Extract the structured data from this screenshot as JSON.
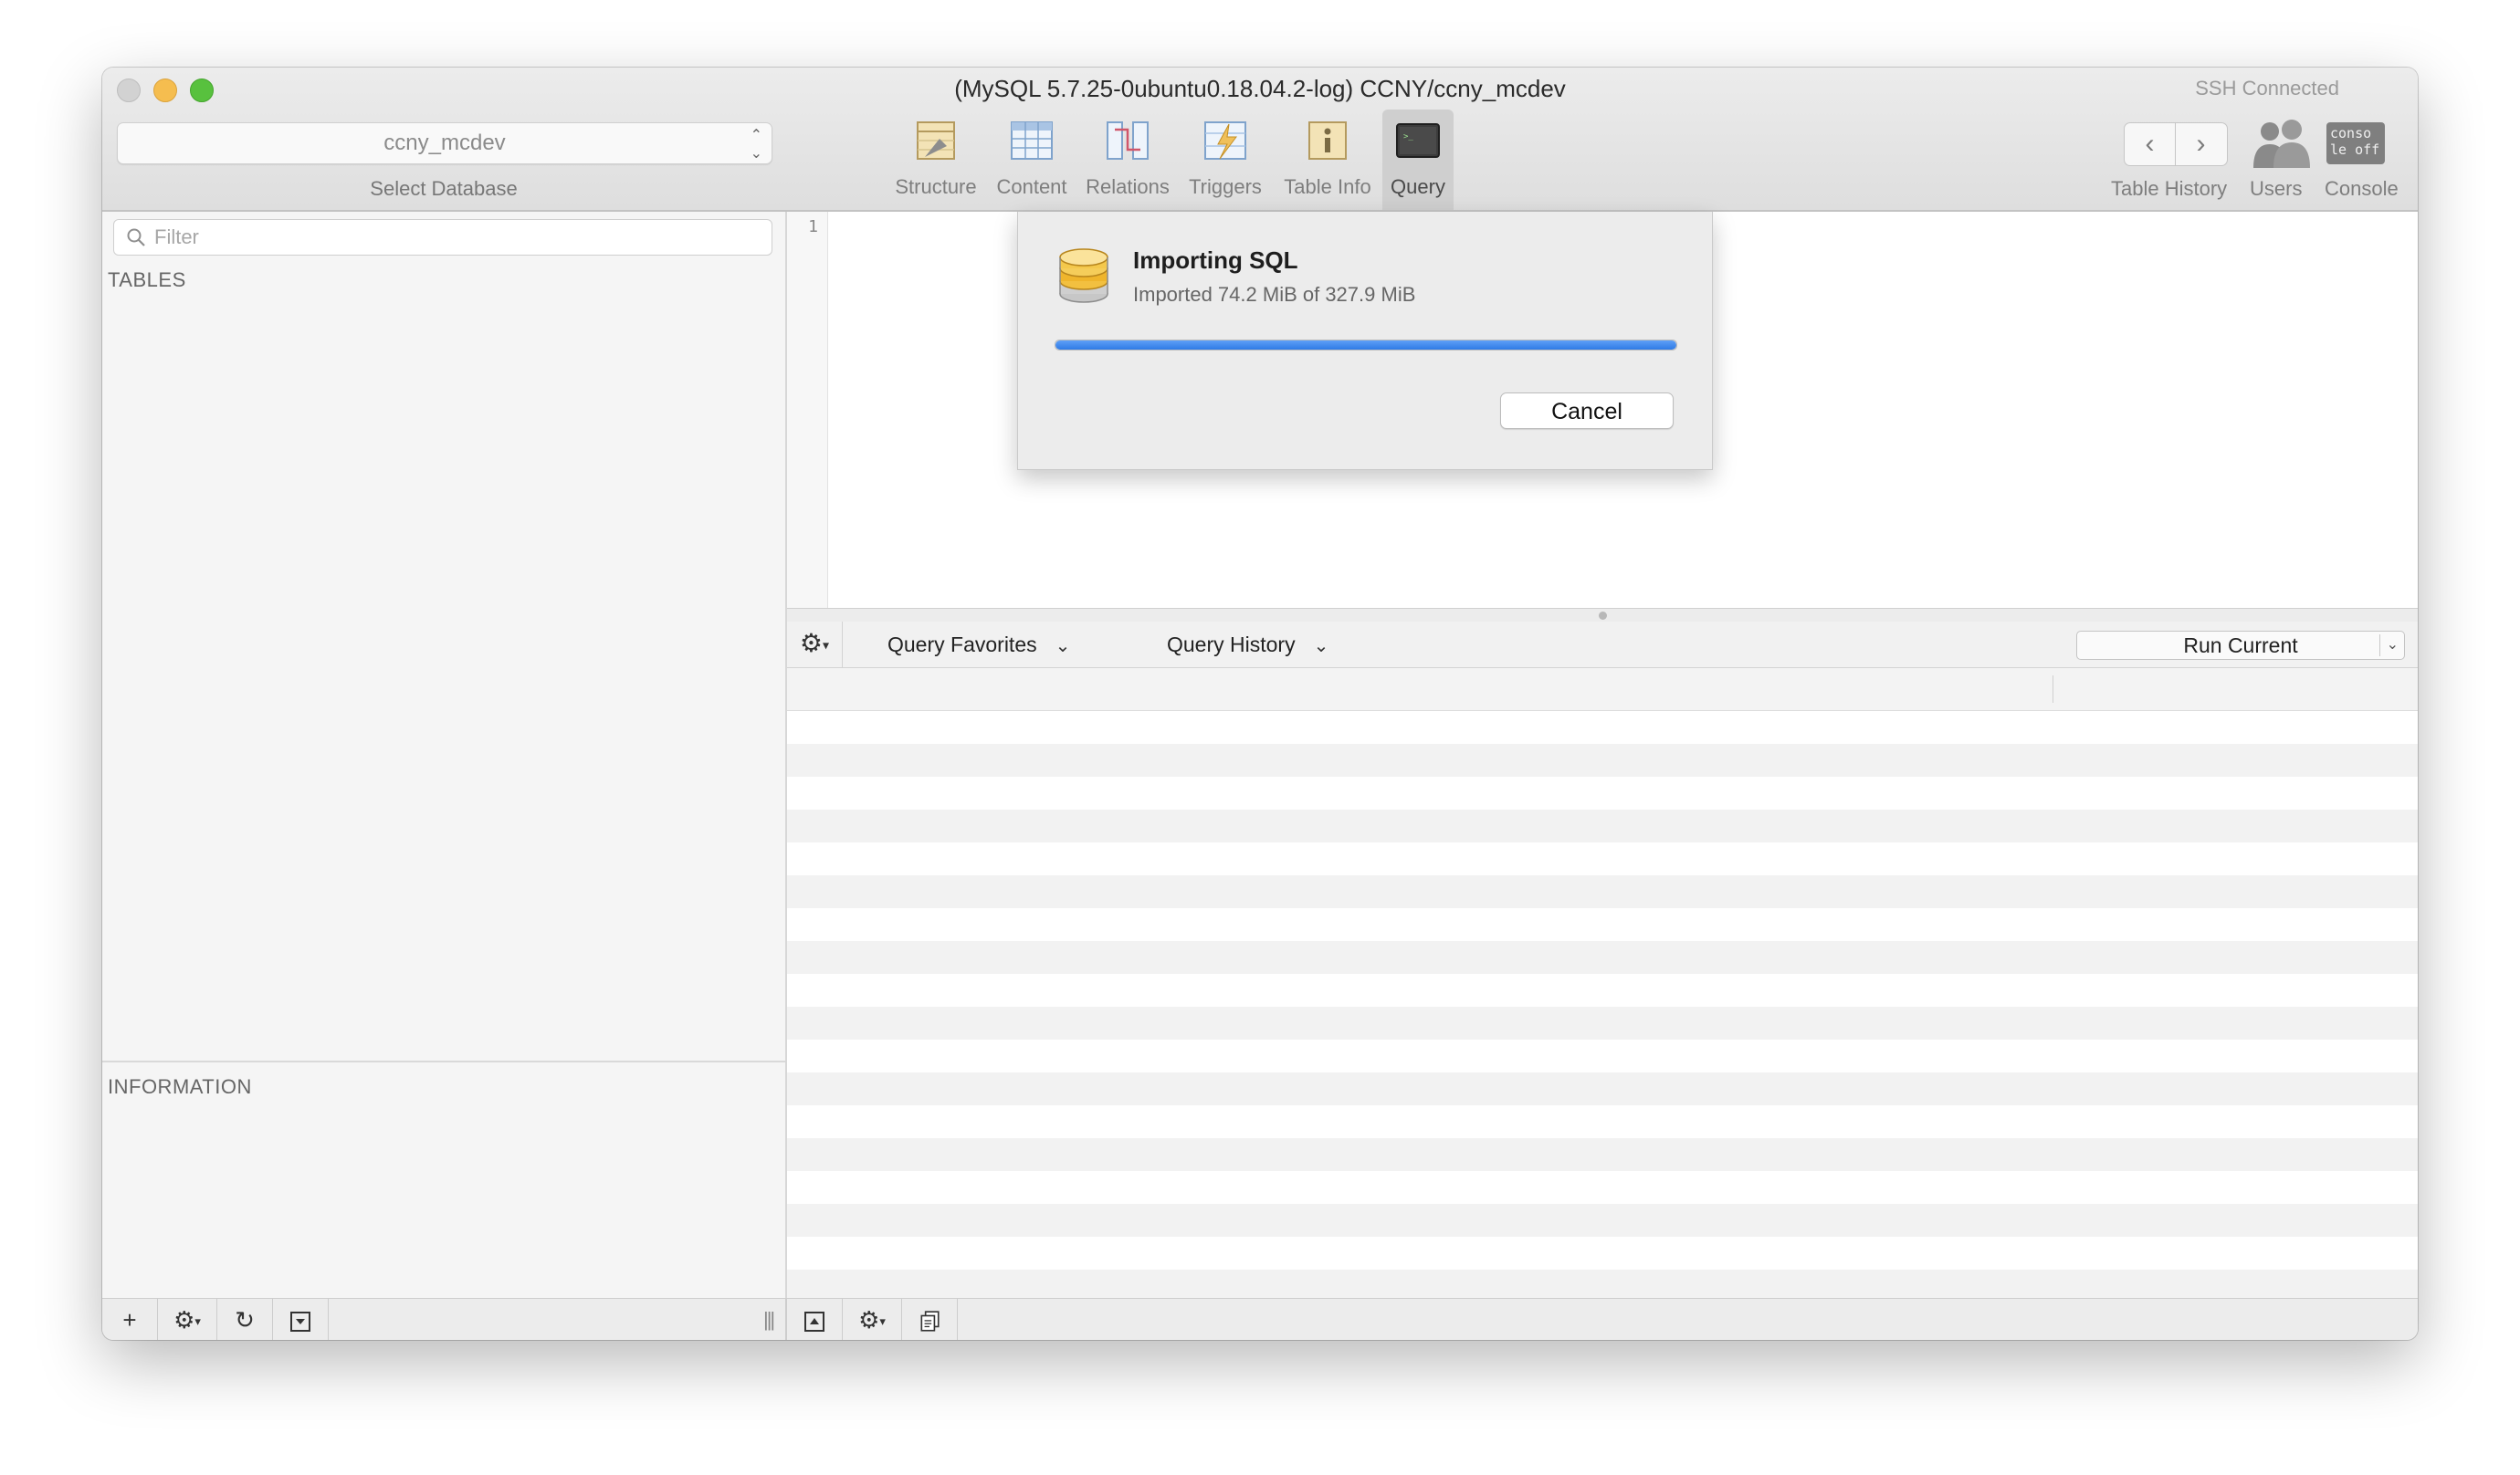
{
  "window": {
    "title": "(MySQL 5.7.25-0ubuntu0.18.04.2-log) CCNY/ccny_mcdev",
    "ssh_status": "SSH Connected"
  },
  "toolbar": {
    "database": "ccny_mcdev",
    "database_caption": "Select Database",
    "tools": [
      {
        "label": "Structure",
        "icon": "structure-icon"
      },
      {
        "label": "Content",
        "icon": "content-icon"
      },
      {
        "label": "Relations",
        "icon": "relations-icon"
      },
      {
        "label": "Triggers",
        "icon": "triggers-icon"
      },
      {
        "label": "Table Info",
        "icon": "table-info-icon"
      },
      {
        "label": "Query",
        "icon": "query-icon",
        "active": true
      }
    ],
    "table_history_label": "Table History",
    "users_label": "Users",
    "console_label": "Console",
    "console_icon_text": "conso le off"
  },
  "sidebar": {
    "filter_placeholder": "Filter",
    "tables_heading": "TABLES",
    "information_heading": "INFORMATION"
  },
  "editor": {
    "line_numbers": [
      "1"
    ]
  },
  "query_bar": {
    "favorites_label": "Query Favorites",
    "history_label": "Query History",
    "run_label": "Run Current"
  },
  "import_sheet": {
    "title": "Importing SQL",
    "status": "Imported 74.2 MiB of 327.9 MiB",
    "progress_fraction": 1.0,
    "cancel_label": "Cancel"
  },
  "colors": {
    "progress": "#2f7ae5",
    "close": "#d2d2d2",
    "minimize": "#f5bd4f",
    "maximize": "#58c13e"
  }
}
